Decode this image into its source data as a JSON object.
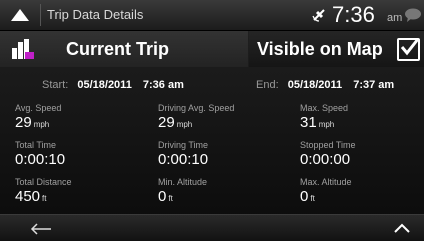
{
  "topbar": {
    "title": "Trip Data Details",
    "time": "7:36",
    "ampm": "am"
  },
  "header": {
    "current_trip": "Current Trip",
    "visible_on_map": "Visible on Map",
    "visible_on_map_checked": true
  },
  "times": {
    "start_label": "Start:",
    "start_date": "05/18/2011",
    "start_time": "7:36 am",
    "end_label": "End:",
    "end_date": "05/18/2011",
    "end_time": "7:37 am"
  },
  "stats": [
    {
      "label": "Avg. Speed",
      "value": "29",
      "unit": "mph"
    },
    {
      "label": "Driving Avg. Speed",
      "value": "29",
      "unit": "mph"
    },
    {
      "label": "Max. Speed",
      "value": "31",
      "unit": "mph"
    },
    {
      "label": "Total Time",
      "value": "0:00:10",
      "unit": ""
    },
    {
      "label": "Driving Time",
      "value": "0:00:10",
      "unit": ""
    },
    {
      "label": "Stopped Time",
      "value": "0:00:00",
      "unit": ""
    },
    {
      "label": "Total Distance",
      "value": "450",
      "unit": "ft"
    },
    {
      "label": "Min. Altitude",
      "value": "0",
      "unit": "ft"
    },
    {
      "label": "Max. Altitude",
      "value": "0",
      "unit": "ft"
    }
  ],
  "icons": {
    "up": "up-arrow-icon",
    "gps": "satellite-icon",
    "messages": "speech-bubble-icon",
    "trip": "trip-stats-icon",
    "check": "checkmark-icon",
    "back": "back-arrow-icon",
    "collapse": "chevron-up-icon"
  },
  "colors": {
    "trip_icon_accent": "#c020c8"
  }
}
